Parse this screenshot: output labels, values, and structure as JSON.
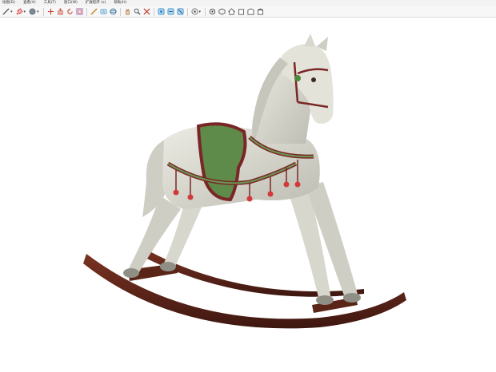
{
  "menu": {
    "items": [
      {
        "label": "绘图(D)"
      },
      {
        "label": "查看(V)"
      },
      {
        "label": "工具(T)"
      },
      {
        "label": "窗口(W)"
      },
      {
        "label": "扩展程序 (x)"
      },
      {
        "label": "帮助(H)"
      }
    ]
  },
  "toolbar": {
    "tools": [
      {
        "name": "line-icon",
        "color": "#333333"
      },
      {
        "name": "paint-bucket-icon",
        "color": "#d62a2a"
      },
      {
        "name": "eraser-icon",
        "color": "#d94c8a"
      },
      {
        "name": "sphere-icon",
        "color": "#5a6a78"
      },
      {
        "name": "move-icon",
        "color": "#c0392b"
      },
      {
        "name": "push-pull-icon",
        "color": "#c0392b"
      },
      {
        "name": "rotate-icon",
        "color": "#c0392b"
      },
      {
        "name": "offset-icon",
        "color": "#8e44ad"
      },
      {
        "name": "dimension-icon",
        "color": "#b9770e"
      },
      {
        "name": "tape-measure-icon",
        "color": "#2e86c1"
      },
      {
        "name": "text-icon",
        "color": "#333333"
      },
      {
        "name": "orbit-icon",
        "color": "#1a5276"
      },
      {
        "name": "pan-icon",
        "color": "#c0392b"
      },
      {
        "name": "zoom-icon",
        "color": "#333333"
      },
      {
        "name": "zoom-extents-icon",
        "color": "#c0392b"
      },
      {
        "name": "section-plane-icon",
        "color": "#2e86c1"
      },
      {
        "name": "section-display-icon",
        "color": "#2e86c1"
      },
      {
        "name": "section-cut-icon",
        "color": "#2e86c1"
      },
      {
        "name": "style-icon",
        "color": "#555555"
      },
      {
        "name": "scenes-icon",
        "color": "#333333"
      },
      {
        "name": "iso-view-icon",
        "color": "#333333"
      },
      {
        "name": "home-view-icon",
        "color": "#333333"
      },
      {
        "name": "front-view-icon",
        "color": "#333333"
      },
      {
        "name": "back-view-icon",
        "color": "#333333"
      },
      {
        "name": "left-view-icon",
        "color": "#333333"
      }
    ]
  },
  "model": {
    "colors": {
      "body": "#e4e3da",
      "body_shade": "#b9b8ae",
      "saddle": "#5e8a4a",
      "saddle_trim": "#7a2626",
      "rocker": "#6b2a1c",
      "rocker_shade": "#3e1710",
      "tassel": "#d23a3a"
    }
  }
}
